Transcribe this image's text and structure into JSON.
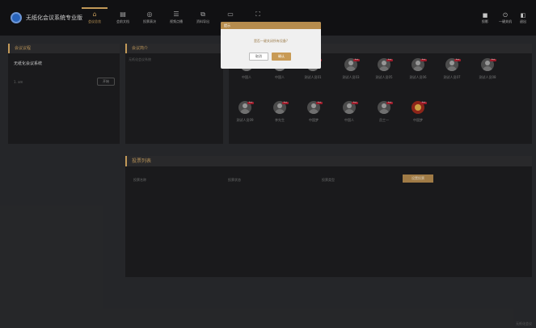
{
  "app": {
    "title": "无纸化会议系统专业版"
  },
  "nav": [
    {
      "label": "会议总览",
      "icon": "home-icon",
      "glyph": "⌂"
    },
    {
      "label": "会前文档",
      "icon": "document-icon",
      "glyph": "▤"
    },
    {
      "label": "投票表决",
      "icon": "vote-icon",
      "glyph": "◎"
    },
    {
      "label": "视频点播",
      "icon": "video-list-icon",
      "glyph": "☰"
    },
    {
      "label": "资料导出",
      "icon": "export-icon",
      "glyph": "⧉"
    },
    {
      "label": "",
      "icon": "screen-icon",
      "glyph": "▭"
    },
    {
      "label": "",
      "icon": "expand-icon",
      "glyph": "⛶"
    }
  ],
  "right_controls": [
    {
      "label": "投影",
      "icon": "camera-icon",
      "glyph": "■"
    },
    {
      "label": "一键关机",
      "icon": "power-icon",
      "glyph": "⏻"
    },
    {
      "label": "退出",
      "icon": "exit-icon",
      "glyph": "◧"
    }
  ],
  "meeting_panel": {
    "title": "会议议程",
    "name": "无纸化会议系统",
    "status": "1. am",
    "start_button": "开始"
  },
  "intro_panel": {
    "title": "会议简介",
    "text": "无纸化会议系统"
  },
  "participants": [
    {
      "name": "中国人",
      "tag": "Host",
      "emblem": false
    },
    {
      "name": "中国人",
      "tag": "Host",
      "emblem": false
    },
    {
      "name": "测试人员01",
      "tag": "Host",
      "emblem": false
    },
    {
      "name": "测试人员03",
      "tag": "Host",
      "emblem": false
    },
    {
      "name": "测试人员05",
      "tag": "Host",
      "emblem": false
    },
    {
      "name": "测试人员06",
      "tag": "Host",
      "emblem": false
    },
    {
      "name": "测试人员07",
      "tag": "Host",
      "emblem": false
    },
    {
      "name": "测试人员08",
      "tag": "Host",
      "emblem": false
    },
    {
      "name": "测试人员09",
      "tag": "Host",
      "emblem": false
    },
    {
      "name": "李先生",
      "tag": "Host",
      "emblem": false
    },
    {
      "name": "中国梦",
      "tag": "Host",
      "emblem": false
    },
    {
      "name": "中国人",
      "tag": "Host",
      "emblem": false
    },
    {
      "name": "员工一",
      "tag": "Host",
      "emblem": false
    },
    {
      "name": "中国梦",
      "tag": "Host",
      "emblem": true
    }
  ],
  "vote_list": {
    "title": "投票列表",
    "columns": [
      "投票名称",
      "投票状态",
      "投票类型"
    ],
    "action": "设置投票"
  },
  "dialog": {
    "title": "提示",
    "message": "是否一键关闭所有设备?",
    "cancel": "取消",
    "confirm": "确认"
  },
  "corner": "无纸化会议",
  "colors": {
    "accent": "#d8ab63",
    "topbar": "#141416",
    "panel": "#1d1e20",
    "background": "#2a2b2e"
  }
}
